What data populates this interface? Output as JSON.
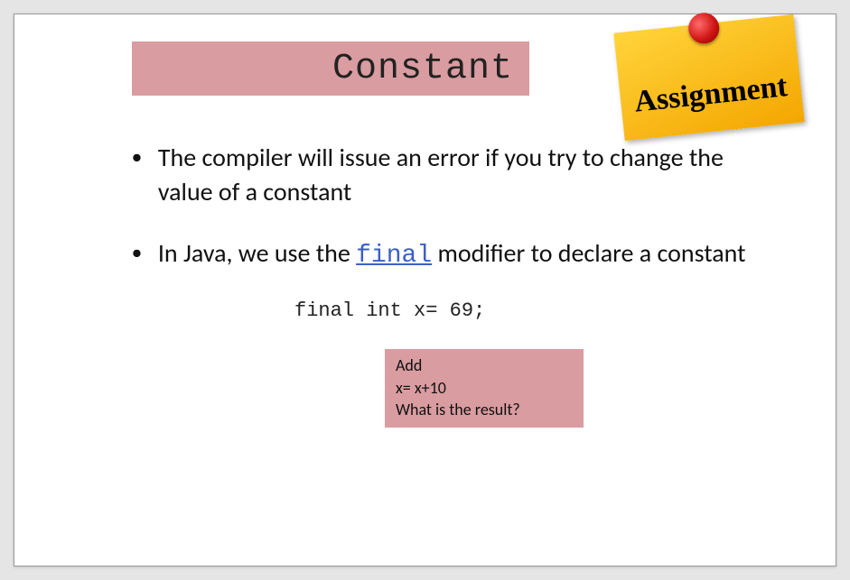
{
  "slide": {
    "title": "Constant",
    "sticky_note": "Assignment",
    "bullets": {
      "b1": "The compiler will issue an error if you try to change the value of a constant",
      "b2_prefix": "In Java, we use the ",
      "b2_code": "final",
      "b2_suffix": " modifier to declare a constant"
    },
    "code_line": "final int x= 69;",
    "question_box": {
      "line1": "Add",
      "line2": "x= x+10",
      "line3": "What is the result?"
    }
  }
}
